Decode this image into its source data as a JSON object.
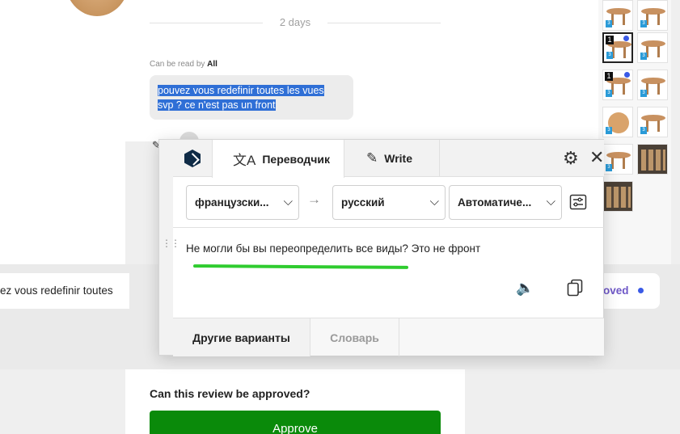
{
  "chat": {
    "date_separator": "2 days",
    "read_by_prefix": "Can be read by",
    "read_by_value": "All",
    "message_line1": "pouvez vous redefinir toutes les vues",
    "message_line2": "svp ? ce n'est pas un front"
  },
  "review_band": {
    "left_text": "ez vous redefinir toutes",
    "right_text": "oved"
  },
  "approval": {
    "question": "Can this review be approved?",
    "approve_label": "Approve"
  },
  "thumbnails": {
    "badge_numbers": [
      "1",
      "1"
    ],
    "badge_small": "3"
  },
  "translator": {
    "tabs": {
      "translator_label": "Переводчик",
      "write_label": "Write"
    },
    "icons": {
      "logo": "deepl-logo-icon",
      "translate": "translate-icon",
      "write": "magic-wand-icon",
      "settings": "gear-icon",
      "close": "close-icon",
      "swap": "arrow-right-icon",
      "glossary": "glossary-settings-icon",
      "speaker": "speaker-icon",
      "copy": "copy-icon"
    },
    "source_language": "французски...",
    "target_language": "русский",
    "formality": "Автоматиче...",
    "result_text": "Не могли бы вы переопределить все виды? Это не фронт",
    "bottom_tabs": {
      "variants_label": "Другие варианты",
      "dictionary_label": "Словарь"
    }
  },
  "colors": {
    "highlight": "#2f6fd6",
    "approve_green": "#0a8a0a",
    "underline_green": "#2fcc2f",
    "accent_purple": "#6e57c7",
    "notification_blue": "#3a5ae6"
  }
}
